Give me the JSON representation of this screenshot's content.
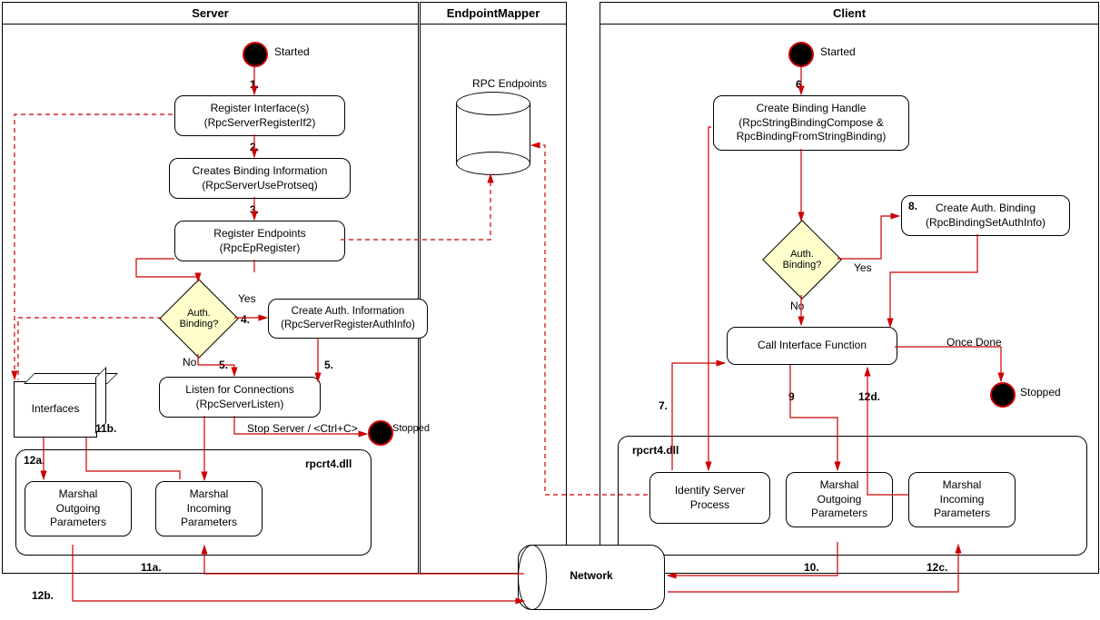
{
  "panels": {
    "server": "Server",
    "endpoint_mapper": "EndpointMapper",
    "client": "Client"
  },
  "server": {
    "started": "Started",
    "register_if": "Register Interface(s)\n(RpcServerRegisterIf2)",
    "binding_info": "Creates Binding Information\n(RpcServerUseProtseq)",
    "register_ep": "Register Endpoints\n(RpcEpRegister)",
    "auth_decision": "Auth.\nBinding?",
    "create_auth": "Create Auth. Information\n(RpcServerRegisterAuthInfo)",
    "listen": "Listen for Connections\n(RpcServerListen)",
    "stop_server": "Stop Server / <Ctrl+C>",
    "interfaces": "Interfaces",
    "marshal_out": "Marshal\nOutgoing\nParameters",
    "marshal_in": "Marshal\nIncoming\nParameters",
    "rpcrt4": "rpcrt4.dll",
    "stopped": "Stopped",
    "yes": "Yes",
    "no": "No"
  },
  "mapper": {
    "rpc_endpoints": "RPC Endpoints"
  },
  "client": {
    "started": "Started",
    "create_binding": "Create Binding Handle\n(RpcStringBindingCompose &\nRpcBindingFromStringBinding)",
    "auth_decision": "Auth.\nBinding?",
    "create_auth": "Create Auth. Binding\n(RpcBindingSetAuthInfo)",
    "call_interface": "Call Interface Function",
    "identify_server": "Identify Server\nProcess",
    "marshal_out": "Marshal\nOutgoing\nParameters",
    "marshal_in": "Marshal\nIncoming\nParameters",
    "rpcrt4": "rpcrt4.dll",
    "stopped": "Stopped",
    "once_done": "Once Done",
    "yes": "Yes",
    "no": "No"
  },
  "network": "Network",
  "steps": {
    "s1": "1.",
    "s2": "2.",
    "s3": "3.",
    "s4": "4.",
    "s5a": "5.",
    "s5b": "5.",
    "s6": "6.",
    "s7": "7.",
    "s8": "8.",
    "s9": "9",
    "s10": "10.",
    "s11a": "11a.",
    "s11b": "11b.",
    "s12a": "12a.",
    "s12b": "12b.",
    "s12c": "12c.",
    "s12d": "12d."
  }
}
